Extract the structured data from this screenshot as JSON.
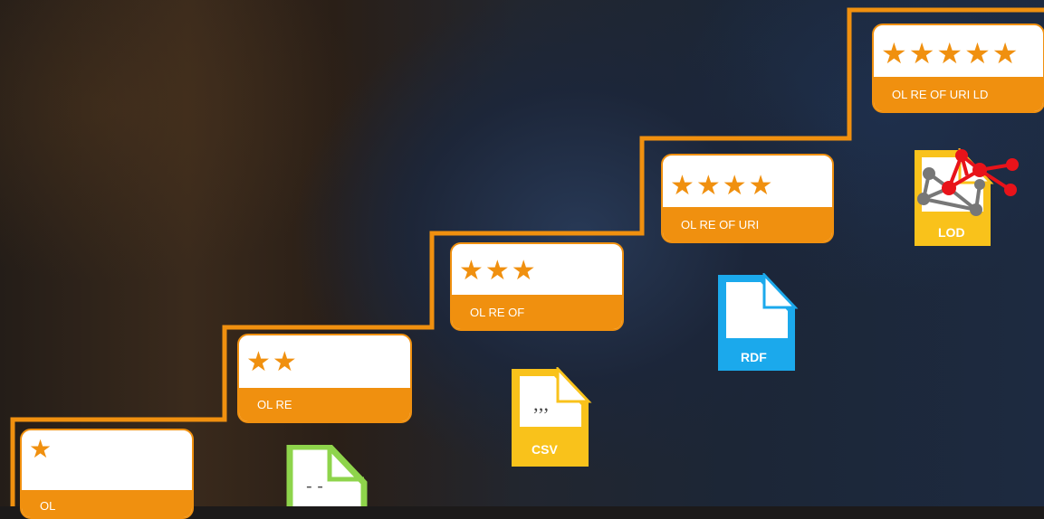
{
  "steps": [
    {
      "stars": "★",
      "label": "OL"
    },
    {
      "stars": "★★",
      "label": "OL  RE"
    },
    {
      "stars": "★★★",
      "label": "OL  RE  OF"
    },
    {
      "stars": "★★★★",
      "label": "OL  RE  OF  URI"
    },
    {
      "stars": "★★★★★",
      "label": "OL  RE  OF  URI LD"
    }
  ],
  "icons": {
    "txt": {
      "name": "text-document-icon",
      "mark": "- -",
      "color": "#8ed44b"
    },
    "csv": {
      "name": "csv-document-icon",
      "mark": "’’’",
      "label": "CSV",
      "color": "#f9c21b"
    },
    "rdf": {
      "name": "rdf-document-icon",
      "label": "RDF",
      "color": "#1ba9ec"
    },
    "lod": {
      "name": "lod-document-icon",
      "label": "LOD",
      "color": "#f9c21b"
    }
  },
  "colors": {
    "accent": "#f0900f",
    "background": "dark-photo"
  }
}
